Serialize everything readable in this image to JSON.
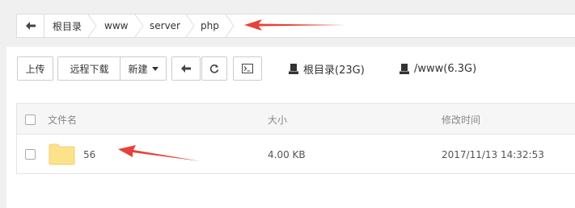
{
  "breadcrumb": {
    "back_icon": "arrow-left-icon",
    "items": [
      "根目录",
      "www",
      "server",
      "php"
    ]
  },
  "toolbar": {
    "upload_label": "上传",
    "remote_download_label": "远程下载",
    "new_label": "新建",
    "back_icon": "arrow-left-icon",
    "refresh_icon": "refresh-icon",
    "terminal_icon": "terminal-icon"
  },
  "disks": [
    {
      "label": "根目录(23G)",
      "icon": "disk-icon"
    },
    {
      "label": "/www(6.3G)",
      "icon": "disk-icon"
    }
  ],
  "table": {
    "headers": {
      "name": "文件名",
      "size": "大小",
      "modified": "修改时间"
    },
    "rows": [
      {
        "name": "56",
        "size": "4.00 KB",
        "modified": "2017/11/13 14:32:53",
        "icon": "folder-icon"
      }
    ]
  },
  "annotation_color": "#e8413a"
}
